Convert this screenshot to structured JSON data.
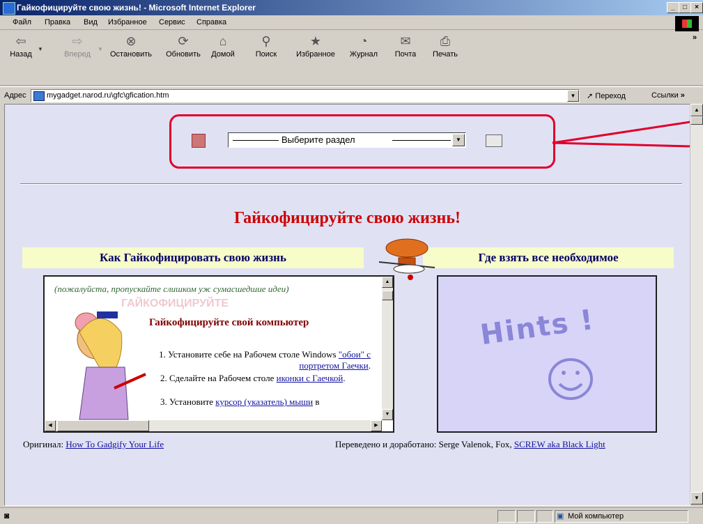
{
  "window": {
    "title": "Гайкофицируйте свою жизнь! - Microsoft Internet Explorer"
  },
  "menu": [
    "Файл",
    "Правка",
    "Вид",
    "Избранное",
    "Сервис",
    "Справка"
  ],
  "toolbar": {
    "back": "Назад",
    "forward": "Вперед",
    "stop": "Остановить",
    "refresh": "Обновить",
    "home": "Домой",
    "search": "Поиск",
    "favorites": "Избранное",
    "history": "Журнал",
    "mail": "Почта",
    "print": "Печать",
    "more": "»"
  },
  "address": {
    "label": "Адрес",
    "url": "mygadget.narod.ru\\gfc\\gfication.htm",
    "go": "Переход",
    "links": "Ссылки",
    "links_more": "»"
  },
  "page": {
    "section_select": "Выберите раздел",
    "title": "Гайкофицируйте свою жизнь!",
    "left_header": "Как Гайкофицировать свою жизнь",
    "right_header": "Где взять все необходимое",
    "left_frame": {
      "intro": "(пожалуйста, пропускайте слишком уж сумасшедшие идеи)",
      "watermark": "ГАЙКОФИЦИРУЙТЕ",
      "subtitle": "Гайкофицируйте свой компьютер",
      "p1_text": "1. Установите себе на Рабочем столе Windows ",
      "p1_link": "\"обои\" с портретом Гаечки",
      "p1_end": ".",
      "p2_text": "2. Сделайте на Рабочем столе ",
      "p2_link": "иконки с Гаечкой",
      "p2_end": ".",
      "p3_text": "3. Установите ",
      "p3_link": "курсор (указатель) мыши",
      "p3_end": " в"
    },
    "right_frame": {
      "hints": "Hints !"
    },
    "footer": {
      "original_label": "Оригинал: ",
      "original_link": "How To Gadgify Your Life",
      "translated_label": "Переведено и доработано: Serge Valenok, Fox, ",
      "translated_link": "SCREW aka Black Light"
    }
  },
  "status": {
    "zone": "Мой компьютер"
  },
  "colors": {
    "highlight": "#e0002a",
    "page_bg": "#e1e1f4",
    "header_bg": "#f8fcc8",
    "title": "#cc0000"
  }
}
